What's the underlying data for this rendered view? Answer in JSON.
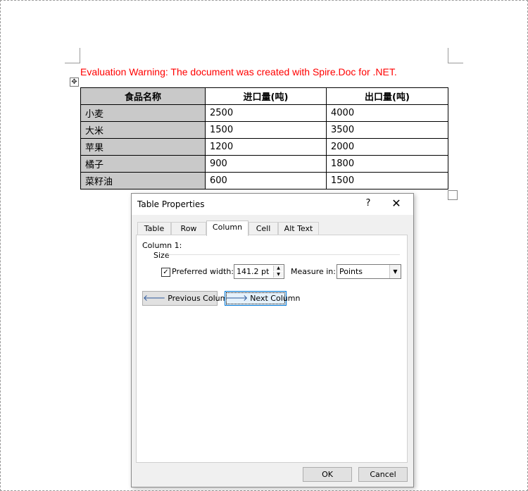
{
  "document": {
    "warning": "Evaluation Warning: The document was created with Spire.Doc for .NET.",
    "table": {
      "headers": [
        "食品名称",
        "进口量(吨)",
        "出口量(吨)"
      ],
      "rows": [
        [
          "小麦",
          "2500",
          "4000"
        ],
        [
          "大米",
          "1500",
          "3500"
        ],
        [
          "苹果",
          "1200",
          "2000"
        ],
        [
          "橘子",
          "900",
          "1800"
        ],
        [
          "菜籽油",
          "600",
          "1500"
        ]
      ]
    }
  },
  "dialog": {
    "title": "Table Properties",
    "help": "?",
    "close": "✕",
    "tabs": [
      {
        "label": "Table"
      },
      {
        "label": "Row"
      },
      {
        "label": "Column"
      },
      {
        "label": "Cell"
      },
      {
        "label": "Alt Text"
      }
    ],
    "column_label": "Column 1:",
    "size_label": "Size",
    "preferred_width_label": "Preferred width:",
    "preferred_width_checked": true,
    "preferred_width_value": "141.2 pt",
    "measure_in_label": "Measure in:",
    "measure_in_value": "Points",
    "previous_column": "Previous Column",
    "next_column": "Next Column",
    "ok": "OK",
    "cancel": "Cancel"
  },
  "icons": {
    "table_move": "table-move-handle-icon",
    "table_resize": "table-resize-handle-icon"
  },
  "colors": {
    "warning": "#ff0000",
    "header_fill": "#c9c9c9",
    "focus_border": "#0078d7"
  }
}
